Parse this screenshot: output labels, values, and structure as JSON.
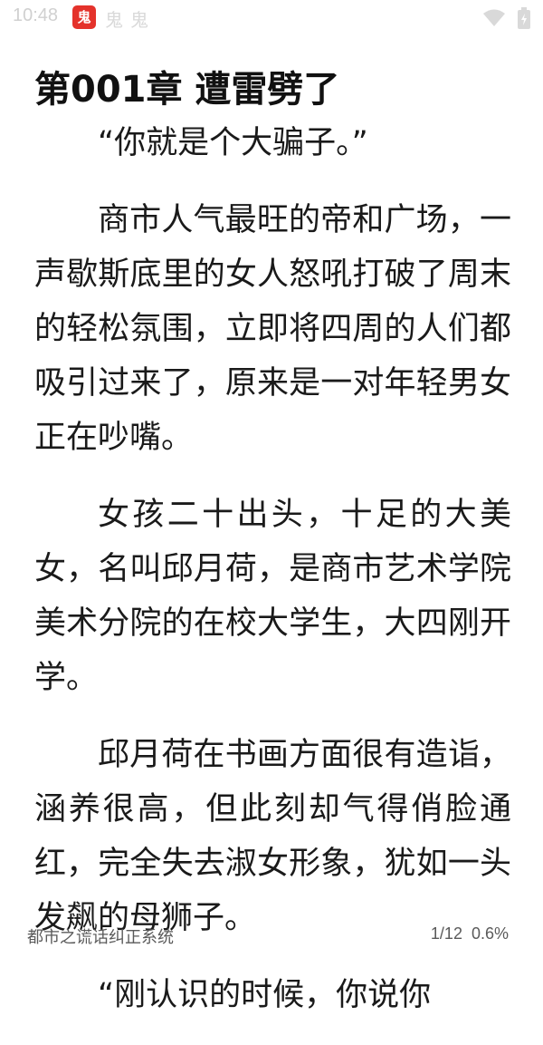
{
  "status_bar": {
    "time": "10:48",
    "app_icon_char": "鬼",
    "notif_1": "鬼",
    "notif_2": "鬼",
    "icons": [
      "wifi-icon",
      "battery-icon"
    ]
  },
  "chapter": {
    "title": "第001章 遭雷劈了"
  },
  "paragraphs": [
    "“你就是个大骗子。”",
    "商市人气最旺的帝和广场，一声歇斯底里的女人怒吼打破了周末的轻松氛围，立即将四周的人们都吸引过来了，原来是一对年轻男女正在吵嘴。",
    "女孩二十出头，十足的大美女，名叫邱月荷，是商市艺术学院美术分院的在校大学生，大四刚开学。",
    "邱月荷在书画方面很有造诣，涵养很高，但此刻却气得俏脸通红，完全失去淑女形象，犹如一头发飙的母狮子。",
    "“刚认识的时候，你说你"
  ],
  "footer": {
    "book_title": "都市之谎话纠正系统",
    "page": "1/12",
    "percent": "0.6%"
  }
}
